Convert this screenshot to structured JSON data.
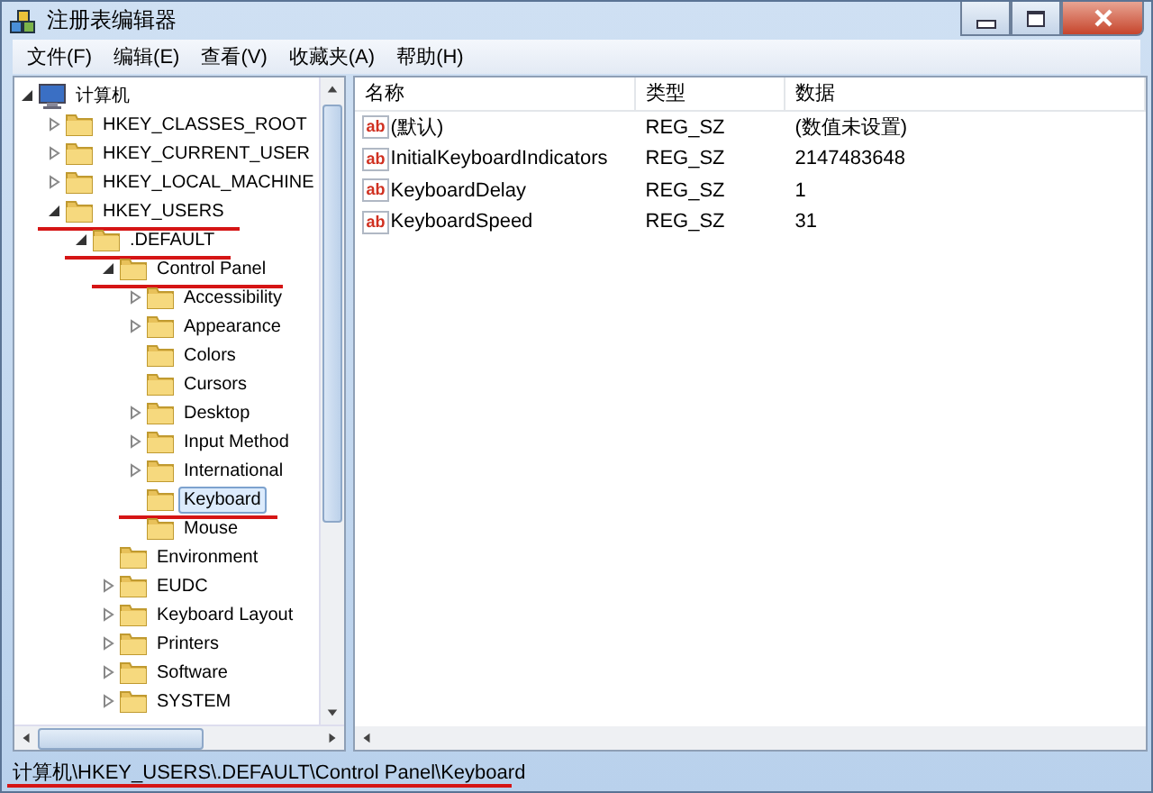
{
  "window": {
    "title": "注册表编辑器"
  },
  "menu": [
    "文件(F)",
    "编辑(E)",
    "查看(V)",
    "收藏夹(A)",
    "帮助(H)"
  ],
  "tree": [
    {
      "label": "计算机",
      "kind": "computer",
      "has_children": true,
      "expanded": true,
      "selected": false,
      "underlined": false,
      "children": [
        {
          "label": "HKEY_CLASSES_ROOT",
          "kind": "folder",
          "has_children": true,
          "expanded": false,
          "selected": false,
          "underlined": false
        },
        {
          "label": "HKEY_CURRENT_USER",
          "kind": "folder",
          "has_children": true,
          "expanded": false,
          "selected": false,
          "underlined": false
        },
        {
          "label": "HKEY_LOCAL_MACHINE",
          "kind": "folder",
          "has_children": true,
          "expanded": false,
          "selected": false,
          "underlined": false
        },
        {
          "label": "HKEY_USERS",
          "kind": "folder",
          "has_children": true,
          "expanded": true,
          "selected": false,
          "underlined": true,
          "children": [
            {
              "label": ".DEFAULT",
              "kind": "folder",
              "has_children": true,
              "expanded": true,
              "selected": false,
              "underlined": true,
              "children": [
                {
                  "label": "Control Panel",
                  "kind": "folder",
                  "has_children": true,
                  "expanded": true,
                  "selected": false,
                  "underlined": true,
                  "children": [
                    {
                      "label": "Accessibility",
                      "kind": "folder",
                      "has_children": true,
                      "expanded": false,
                      "selected": false,
                      "underlined": false
                    },
                    {
                      "label": "Appearance",
                      "kind": "folder",
                      "has_children": true,
                      "expanded": false,
                      "selected": false,
                      "underlined": false
                    },
                    {
                      "label": "Colors",
                      "kind": "folder",
                      "has_children": false,
                      "selected": false,
                      "underlined": false
                    },
                    {
                      "label": "Cursors",
                      "kind": "folder",
                      "has_children": false,
                      "selected": false,
                      "underlined": false
                    },
                    {
                      "label": "Desktop",
                      "kind": "folder",
                      "has_children": true,
                      "expanded": false,
                      "selected": false,
                      "underlined": false
                    },
                    {
                      "label": "Input Method",
                      "kind": "folder",
                      "has_children": true,
                      "expanded": false,
                      "selected": false,
                      "underlined": false
                    },
                    {
                      "label": "International",
                      "kind": "folder",
                      "has_children": true,
                      "expanded": false,
                      "selected": false,
                      "underlined": false
                    },
                    {
                      "label": "Keyboard",
                      "kind": "folder",
                      "has_children": false,
                      "selected": true,
                      "underlined": true
                    },
                    {
                      "label": "Mouse",
                      "kind": "folder",
                      "has_children": false,
                      "selected": false,
                      "underlined": false
                    }
                  ]
                },
                {
                  "label": "Environment",
                  "kind": "folder",
                  "has_children": false,
                  "selected": false,
                  "underlined": false
                },
                {
                  "label": "EUDC",
                  "kind": "folder",
                  "has_children": true,
                  "expanded": false,
                  "selected": false,
                  "underlined": false
                },
                {
                  "label": "Keyboard Layout",
                  "kind": "folder",
                  "has_children": true,
                  "expanded": false,
                  "selected": false,
                  "underlined": false
                },
                {
                  "label": "Printers",
                  "kind": "folder",
                  "has_children": true,
                  "expanded": false,
                  "selected": false,
                  "underlined": false
                },
                {
                  "label": "Software",
                  "kind": "folder",
                  "has_children": true,
                  "expanded": false,
                  "selected": false,
                  "underlined": false
                },
                {
                  "label": "SYSTEM",
                  "kind": "folder",
                  "has_children": true,
                  "expanded": false,
                  "selected": false,
                  "underlined": false
                }
              ]
            }
          ]
        }
      ]
    }
  ],
  "table": {
    "columns": [
      "名称",
      "类型",
      "数据"
    ],
    "rows": [
      {
        "icon": "ab",
        "name": "(默认)",
        "type": "REG_SZ",
        "data": "(数值未设置)"
      },
      {
        "icon": "ab",
        "name": "InitialKeyboardIndicators",
        "type": "REG_SZ",
        "data": "2147483648"
      },
      {
        "icon": "ab",
        "name": "KeyboardDelay",
        "type": "REG_SZ",
        "data": "1"
      },
      {
        "icon": "ab",
        "name": "KeyboardSpeed",
        "type": "REG_SZ",
        "data": "31"
      }
    ]
  },
  "status_bar": {
    "text": "计算机\\HKEY_USERS\\.DEFAULT\\Control Panel\\Keyboard",
    "underlined": true
  }
}
